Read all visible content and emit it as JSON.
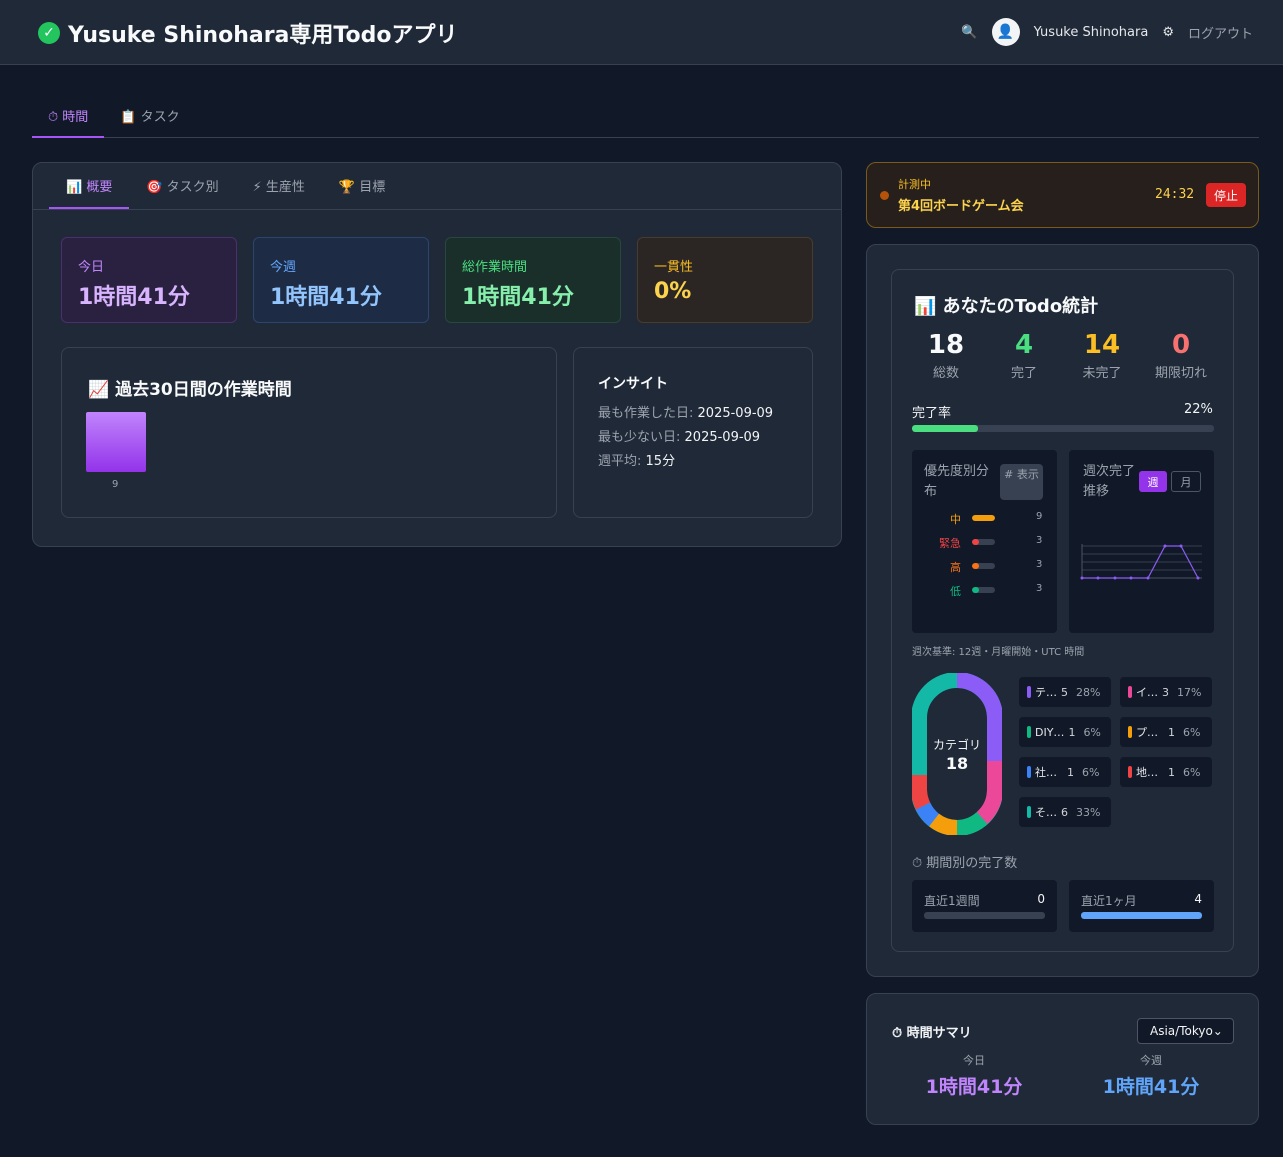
{
  "app": {
    "title": "Yusuke Shinohara専用Todoアプリ"
  },
  "header": {
    "search_icon": "🔍",
    "user_name": "Yusuke Shinohara",
    "logout": "ログアウト"
  },
  "main_tabs": [
    {
      "label": "⏱ 時間"
    },
    {
      "label": "📋 タスク"
    }
  ],
  "sub_tabs": [
    {
      "label": "📊 概要"
    },
    {
      "label": "🎯 タスク別"
    },
    {
      "label": "⚡ 生産性"
    },
    {
      "label": "🏆 目標"
    }
  ],
  "stats": [
    {
      "label": "今日",
      "value": "1時間41分"
    },
    {
      "label": "今週",
      "value": "1時間41分"
    },
    {
      "label": "総作業時間",
      "value": "1時間41分"
    },
    {
      "label": "一貫性",
      "value": "0%"
    }
  ],
  "history": {
    "title": "📈 過去30日間の作業時間",
    "bar_label": "9"
  },
  "insight": {
    "title": "インサイト",
    "most_label": "最も作業した日:",
    "most_value": "2025-09-09",
    "least_label": "最も少ない日:",
    "least_value": "2025-09-09",
    "avg_label": "週平均:",
    "avg_value": "15分"
  },
  "timer": {
    "status": "計測中",
    "task": "第4回ボードゲーム会",
    "time": "24:32",
    "stop": "停止"
  },
  "todo_stats": {
    "title": "📊 あなたのTodo統計",
    "counts": [
      {
        "value": "18",
        "label": "総数"
      },
      {
        "value": "4",
        "label": "完了"
      },
      {
        "value": "14",
        "label": "未完了"
      },
      {
        "value": "0",
        "label": "期限切れ"
      }
    ],
    "completion_label": "完了率",
    "completion_value": "22%",
    "completion_fraction": 0.22,
    "priority_title": "優先度別分布",
    "priority_toggle": "# 表示",
    "priorities": [
      {
        "label": "中",
        "count": "9"
      },
      {
        "label": "緊急",
        "count": "3"
      },
      {
        "label": "高",
        "count": "3"
      },
      {
        "label": "低",
        "count": "3"
      }
    ],
    "weekly_title": "週次完了推移",
    "week_btn": "週",
    "month_btn": "月",
    "basis": "週次基準: 12週・月曜開始・UTC 時間",
    "donut_label": "カテゴリ",
    "donut_total": "18",
    "categories": [
      {
        "name": "テ…",
        "count": "5",
        "pct": "28%"
      },
      {
        "name": "イ…",
        "count": "3",
        "pct": "17%"
      },
      {
        "name": "DIY…",
        "count": "1",
        "pct": "6%"
      },
      {
        "name": "プ…",
        "count": "1",
        "pct": "6%"
      },
      {
        "name": "社…",
        "count": "1",
        "pct": "6%"
      },
      {
        "name": "地…",
        "count": "1",
        "pct": "6%"
      },
      {
        "name": "そ…",
        "count": "6",
        "pct": "33%"
      }
    ],
    "period_title": "⏱ 期間別の完了数",
    "periods": [
      {
        "label": "直近1週間",
        "value": "0"
      },
      {
        "label": "直近1ヶ月",
        "value": "4"
      }
    ]
  },
  "summary": {
    "title": "⏱ 時間サマリ",
    "timezone": "Asia/Tokyo",
    "today_label": "今日",
    "today_value": "1時間41分",
    "week_label": "今週",
    "week_value": "1時間41分"
  },
  "colors": {
    "purple": "#a855f7",
    "blue": "#60a5fa",
    "green": "#4ade80",
    "yellow": "#fbbf24",
    "red": "#dc2626"
  }
}
